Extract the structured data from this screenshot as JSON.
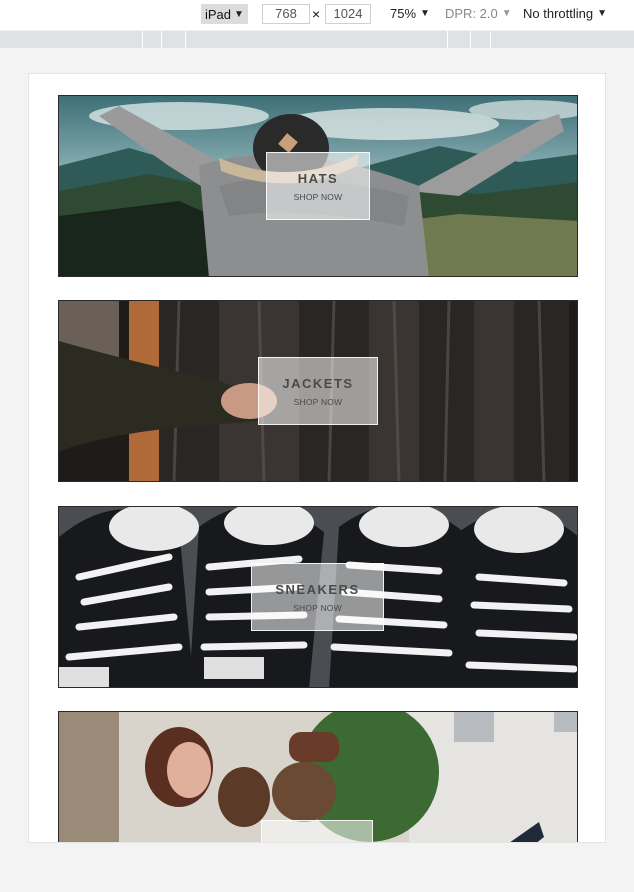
{
  "devtools": {
    "device": "iPad",
    "width": "768",
    "height": "1024",
    "separator": "×",
    "zoom": "75%",
    "dpr": "DPR: 2.0",
    "throttling": "No throttling"
  },
  "banners": [
    {
      "title": "HATS",
      "cta": "SHOP NOW"
    },
    {
      "title": "JACKETS",
      "cta": "SHOP NOW"
    },
    {
      "title": "SNEAKERS",
      "cta": "SHOP NOW"
    },
    {
      "title": "",
      "cta": ""
    }
  ],
  "colors": {
    "toolbar_bg": "#ffffff",
    "mq_bar": "#dfe1e5",
    "page_bg": "#f3f3f3"
  }
}
